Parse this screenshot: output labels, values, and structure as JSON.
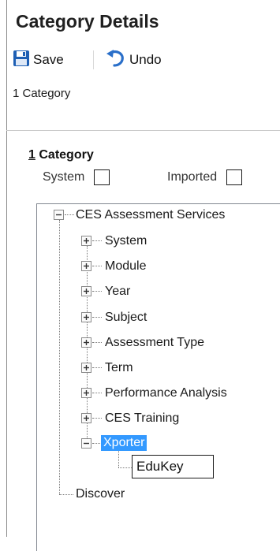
{
  "header": {
    "title": "Category Details"
  },
  "toolbar": {
    "save_label": "Save",
    "undo_label": "Undo"
  },
  "breadcrumb": {
    "text": "1 Category"
  },
  "group": {
    "accel": "1",
    "title": "Category"
  },
  "flags": {
    "system_label": "System",
    "imported_label": "Imported"
  },
  "tree": {
    "root": "CES Assessment Services",
    "children": [
      "System",
      "Module",
      "Year",
      "Subject",
      "Assessment Type",
      "Term",
      "Performance Analysis",
      "CES Training"
    ],
    "expanded_child": "Xporter",
    "editing_value": "EduKey",
    "sibling_root": "Discover"
  },
  "colors": {
    "selection": "#3399ff",
    "save_icon": "#1e5fb4",
    "undo_icon": "#2a6fc9"
  },
  "icons": {
    "save": "floppy-disk-icon",
    "undo": "undo-arrow-icon",
    "expand": "plus-expander-icon",
    "collapse": "minus-expander-icon"
  }
}
